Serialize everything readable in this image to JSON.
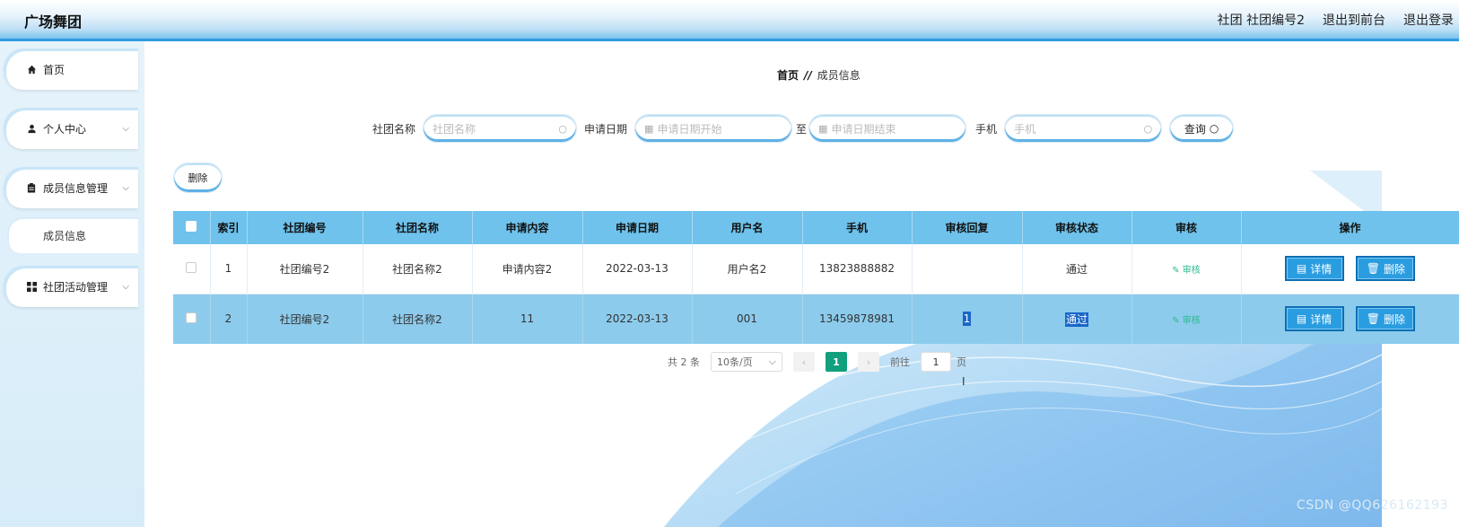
{
  "header": {
    "app_title": "广场舞团",
    "club_label": "社团 社团编号2",
    "to_front": "退出到前台",
    "logout": "退出登录"
  },
  "sidebar": {
    "items": [
      {
        "label": "首页",
        "icon": "home-icon"
      },
      {
        "label": "个人中心",
        "icon": "user-icon"
      },
      {
        "label": "成员信息管理",
        "icon": "clipboard-icon"
      },
      {
        "label": "成员信息",
        "icon": ""
      },
      {
        "label": "社团活动管理",
        "icon": "grid-icon"
      }
    ]
  },
  "breadcrumb": {
    "home": "首页",
    "separator": "//",
    "current": "成员信息"
  },
  "search": {
    "club_name_label": "社团名称",
    "club_name_placeholder": "社团名称",
    "apply_date_label": "申请日期",
    "date_start_placeholder": "申请日期开始",
    "date_to": "至",
    "date_end_placeholder": "申请日期结束",
    "phone_label": "手机",
    "phone_placeholder": "手机",
    "query_label": "查询"
  },
  "toolbar": {
    "delete_label": "删除"
  },
  "table": {
    "headers": [
      "",
      "索引",
      "社团编号",
      "社团名称",
      "申请内容",
      "申请日期",
      "用户名",
      "手机",
      "审核回复",
      "审核状态",
      "审核",
      "操作"
    ],
    "rows": [
      {
        "index": "1",
        "club_no": "社团编号2",
        "club_name": "社团名称2",
        "content": "申请内容2",
        "date": "2022-03-13",
        "username": "用户名2",
        "phone": "13823888882",
        "reply": "",
        "status": "通过",
        "audit": "审核"
      },
      {
        "index": "2",
        "club_no": "社团编号2",
        "club_name": "社团名称2",
        "content": "11",
        "date": "2022-03-13",
        "username": "001",
        "phone": "13459878981",
        "reply": "1",
        "status": "通过",
        "audit": "审核"
      }
    ],
    "detail_label": "详情",
    "delete_label": "删除"
  },
  "pagination": {
    "total": "共 2 条",
    "page_size": "10条/页",
    "current_page": "1",
    "goto_label": "前往",
    "goto_value": "1",
    "page_unit": "页"
  },
  "watermark": "CSDN @QQ626162193",
  "colors": {
    "header_accent": "#2e9be0",
    "table_header": "#6ec2ec",
    "selected_row": "#8ccbec",
    "action_button": "#2a9de0",
    "pager_active": "#12a07c"
  }
}
